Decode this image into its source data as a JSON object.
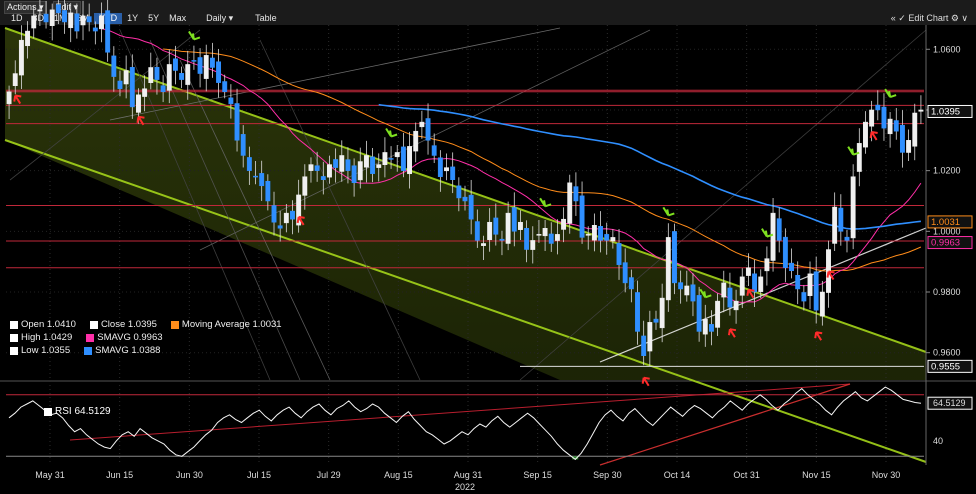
{
  "toolbar": {
    "actions_label": "Actions ▾",
    "edit_label": "Edit ▾",
    "ranges": [
      "1D",
      "3D",
      "1M",
      "6M",
      "YTD",
      "1Y",
      "5Y",
      "Max"
    ],
    "active_range": "YTD",
    "frequency_label": "Daily ▾",
    "table_label": "Table",
    "edit_chart_label": "« ✓ Edit Chart ⚙ ∨"
  },
  "legend": {
    "open": "Open 1.0410",
    "high": "High 1.0429",
    "low": "Low 1.0355",
    "close": "Close 1.0395",
    "sma_short": "SMAVG 0.9963",
    "sma_long": "SMAVG 1.0388",
    "moving_average": "Moving Average 1.0031",
    "rsi": "RSI 64.5129",
    "colors": {
      "open": "#ffffff",
      "close": "#ffffff",
      "sma_short": "#ff2fa8",
      "sma_long": "#2f8fff",
      "moving_average": "#ff8c1a"
    }
  },
  "chart_data": [
    {
      "type": "candlestick",
      "x_tick_labels": [
        "May 31",
        "Jun 15",
        "Jun 30",
        "Jul 15",
        "Jul 29",
        "Aug 15",
        "Aug 31",
        "Sep 15",
        "Sep 30",
        "Oct 14",
        "Oct 31",
        "Nov 15",
        "Nov 30"
      ],
      "x_year_label": "2022",
      "y_tick_labels": [
        "1.0600",
        "1.0400",
        "1.0200",
        "1.0000",
        "0.9800",
        "0.9600"
      ],
      "ylim": [
        0.951,
        1.068
      ],
      "last_price_labels": [
        {
          "value": "1.0395",
          "color": "#ffffff"
        },
        {
          "value": "1.0031",
          "color": "#ff8c1a"
        },
        {
          "value": "0.9963",
          "color": "#ff2fa8"
        },
        {
          "value": "0.9555",
          "color": "#ffffff"
        }
      ],
      "close_series": [
        1.046,
        1.052,
        1.063,
        1.066,
        1.071,
        1.073,
        1.069,
        1.073,
        1.072,
        1.069,
        1.072,
        1.066,
        1.071,
        1.069,
        1.066,
        1.071,
        1.059,
        1.051,
        1.047,
        1.053,
        1.041,
        1.045,
        1.047,
        1.054,
        1.05,
        1.046,
        1.055,
        1.053,
        1.05,
        1.055,
        1.056,
        1.052,
        1.058,
        1.054,
        1.049,
        1.046,
        1.042,
        1.03,
        1.025,
        1.02,
        1.018,
        1.015,
        1.01,
        1.003,
        1.001,
        1.006,
        1.004,
        1.012,
        1.018,
        1.022,
        1.02,
        1.017,
        1.022,
        1.021,
        1.025,
        1.02,
        1.016,
        1.023,
        1.025,
        1.019,
        1.022,
        1.026,
        1.024,
        1.026,
        1.02,
        1.028,
        1.033,
        1.036,
        1.03,
        1.025,
        1.018,
        1.021,
        1.017,
        1.011,
        1.01,
        1.004,
        0.997,
        0.996,
        1.003,
        0.999,
        0.997,
        1.006,
        1.0,
        1.003,
        0.994,
        0.997,
        0.999,
        1.001,
        0.996,
        0.999,
        1.004,
        1.016,
        1.01,
        0.998,
        0.999,
        1.002,
        0.997,
        0.997,
        0.998,
        0.989,
        0.983,
        0.981,
        0.967,
        0.959,
        0.97,
        0.97,
        0.978,
        0.998,
        0.983,
        0.981,
        0.982,
        0.977,
        0.967,
        0.971,
        0.967,
        0.977,
        0.983,
        0.975,
        0.977,
        0.985,
        0.988,
        0.98,
        0.985,
        0.991,
        1.006,
        0.997,
        0.988,
        0.987,
        0.981,
        0.977,
        0.986,
        0.974,
        0.98,
        0.994,
        1.008,
        1.0,
        0.997,
        1.018,
        1.029,
        1.036,
        1.04,
        1.04,
        1.034,
        1.037,
        1.033,
        1.026,
        1.03,
        1.039,
        1.04
      ],
      "reference_lines": [
        1.0465,
        1.046,
        1.0415,
        1.0355,
        1.0085,
        0.9968,
        0.988,
        0.9555
      ]
    },
    {
      "type": "line",
      "name": "RSI",
      "y_tick_labels": [
        "64.5129",
        "40"
      ],
      "ylim": [
        25,
        77
      ],
      "levels": [
        70,
        30
      ],
      "values": [
        55,
        58,
        62,
        64,
        66,
        63,
        60,
        57,
        58,
        55,
        50,
        46,
        48,
        44,
        41,
        38,
        36,
        35,
        40,
        44,
        46,
        43,
        48,
        45,
        42,
        40,
        38,
        34,
        31,
        30,
        33,
        36,
        40,
        44,
        47,
        52,
        55,
        57,
        54,
        52,
        55,
        58,
        60,
        56,
        53,
        57,
        60,
        62,
        58,
        55,
        59,
        62,
        64,
        60,
        57,
        61,
        63,
        66,
        62,
        59,
        61,
        64,
        62,
        58,
        55,
        52,
        56,
        59,
        54,
        50,
        46,
        44,
        41,
        38,
        40,
        43,
        46,
        44,
        48,
        51,
        49,
        53,
        56,
        52,
        49,
        52,
        55,
        58,
        55,
        51,
        47,
        43,
        38,
        34,
        31,
        28,
        32,
        38,
        45,
        52,
        57,
        60,
        56,
        53,
        58,
        61,
        57,
        53,
        50,
        54,
        58,
        62,
        59,
        56,
        60,
        63,
        61,
        58,
        55,
        59,
        62,
        66,
        63,
        60,
        64,
        67,
        70,
        67,
        63,
        60,
        64,
        67,
        71,
        74,
        70,
        67,
        64,
        60,
        57,
        62,
        66,
        69,
        72,
        68,
        66,
        69,
        72,
        75,
        73,
        70,
        67,
        66,
        65,
        64.5
      ]
    }
  ]
}
